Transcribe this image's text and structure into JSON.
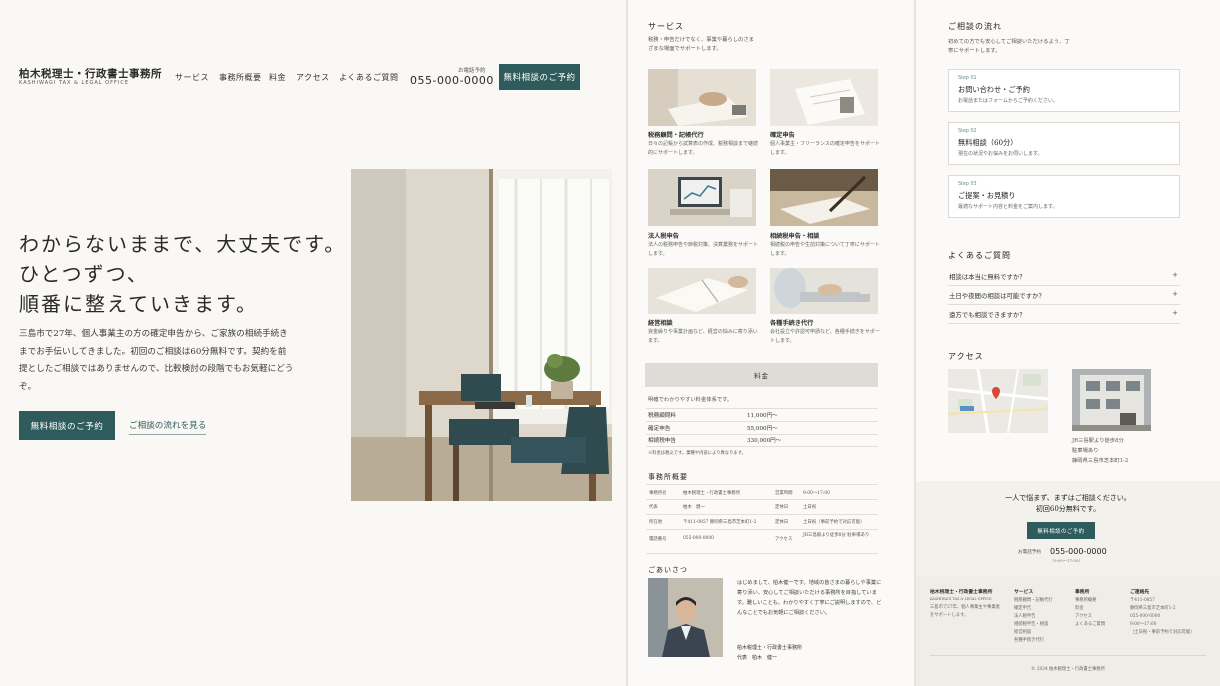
{
  "header": {
    "logo_jp": "柏木税理士・行政書士事務所",
    "logo_en": "KASHIWAGI TAX & LEGAL OFFICE",
    "nav": [
      "サービス",
      "事務所概要",
      "料金",
      "アクセス",
      "よくあるご質問"
    ],
    "tel_label": "お電話予約",
    "tel": "055-000-0000",
    "cta": "無料相談のご予約"
  },
  "hero": {
    "line1": "わからないままで、大丈夫です。",
    "line2": "ひとつずつ、",
    "line3": "順番に整えていきます。",
    "desc": "三島市で27年、個人事業主の方の確定申告から、ご家族の相続手続きまでお手伝いしてきました。初回のご相談は60分無料です。契約を前提としたご相談ではありませんので、比較検討の段階でもお気軽にどうぞ。",
    "cta_primary": "無料相談のご予約",
    "cta_link": "ご相談の流れを見る"
  },
  "services": {
    "title": "サービス",
    "intro": "税務・申告だけでなく、事業や暮らしのさまざまな場面でサポートします。",
    "items": [
      {
        "title": "税務顧問・記帳代行",
        "desc": "日々の記帳から試算表の作成、税務相談まで継続的にサポートします。"
      },
      {
        "title": "確定申告",
        "desc": "個人事業主・フリーランスの確定申告をサポートします。"
      },
      {
        "title": "法人税申告",
        "desc": "法人の税務申告や節税対策、決算業務をサポートします。"
      },
      {
        "title": "相続税申告・相談",
        "desc": "相続税の申告や生前対策について丁寧にサポートします。"
      },
      {
        "title": "経営相談",
        "desc": "資金繰りや事業計画など、経営の悩みに寄り添います。"
      },
      {
        "title": "各種手続き代行",
        "desc": "会社設立や許認可申請など、各種手続きをサポートします。"
      }
    ]
  },
  "pricing": {
    "banner": "料金",
    "intro": "明確でわかりやすい料金体系です。",
    "rows": [
      {
        "label": "税務顧問料",
        "value": "11,000円〜"
      },
      {
        "label": "確定申告",
        "value": "55,000円〜"
      },
      {
        "label": "相続税申告",
        "value": "330,000円〜"
      }
    ],
    "note": "※料金は税込です。業種や内容により異なります。"
  },
  "office": {
    "title": "事務所概要",
    "rows": [
      {
        "k1": "事務所名",
        "v1": "柏木税理士・行政書士事務所",
        "k2": "営業時間",
        "v2": "9:00〜17:00"
      },
      {
        "k1": "代表",
        "v1": "柏木　健一",
        "k2": "定休日",
        "v2": "土日祝"
      },
      {
        "k1": "所在地",
        "v1": "〒411-0857 静岡県三島市芝本町1-2",
        "k2": "定休日",
        "v2": "土日祝（事前予約で対応可能）"
      },
      {
        "k1": "電話番号",
        "v1": "055-000-0000",
        "k2": "アクセス",
        "v2": "JR三島駅より徒歩8分 駐車場あり"
      }
    ]
  },
  "greeting": {
    "title": "ごあいさつ",
    "text": "はじめまして、柏木健一です。地域の皆さまの暮らしや事業に寄り添い、安心してご相談いただける事務所を目指しています。難しいことも、わかりやすく丁寧にご説明しますので、どんなことでもお気軽にご相談ください。",
    "org": "柏木税理士・行政書士事務所",
    "name": "代表　柏木　健一"
  },
  "flow": {
    "title": "ご相談の流れ",
    "intro": "初めての方でも安心してご相談いただけるよう、丁寧にサポートします。",
    "steps": [
      {
        "num": "Step 01",
        "title": "お問い合わせ・ご予約",
        "desc": "お電話またはフォームからご予約ください。"
      },
      {
        "num": "Step 02",
        "title": "無料相談（60分）",
        "desc": "現在の状況やお悩みをお伺いします。"
      },
      {
        "num": "Step 03",
        "title": "ご提案・お見積り",
        "desc": "最適なサポート内容と料金をご案内します。"
      }
    ]
  },
  "faq": {
    "title": "よくあるご質問",
    "items": [
      "相談は本当に無料ですか？",
      "土日や夜間の相談は可能ですか？",
      "遠方でも相談できますか？"
    ]
  },
  "access": {
    "title": "アクセス",
    "lines": [
      "JR三島駅より徒歩8分",
      "駐車場あり",
      "静岡県三島市芝本町1-2"
    ]
  },
  "cta": {
    "line1": "一人で悩まず、まずはご相談ください。",
    "line2": "初回60分無料です。",
    "button": "無料相談のご予約",
    "tel_label": "お電話予約",
    "tel": "055-000-0000",
    "hours": "（9:00〜17:00）"
  },
  "footer": {
    "org": "柏木税理士・行政書士事務所",
    "org_en": "KASHIWAGI TAX & LEGAL OFFICE",
    "org_desc": [
      "三島市で27年、個人事業主や事業者",
      "をサポートします。"
    ],
    "col1_title": "サービス",
    "col1": [
      "税務顧問・記帳代行",
      "確定申告",
      "法人税申告",
      "相続税申告・相談",
      "経営相談",
      "各種手続き代行"
    ],
    "col2_title": "事務所",
    "col2": [
      "事務所概要",
      "料金",
      "アクセス",
      "よくあるご質問"
    ],
    "col3_title": "ご連絡先",
    "col3": [
      "〒411-0857",
      "静岡県三島市芝本町1-2",
      "055-000-0000",
      "9:00〜17:00",
      "（土日祝・事前予約で対応可能）"
    ],
    "copyright": "© 2024 柏木税理士・行政書士事務所"
  }
}
